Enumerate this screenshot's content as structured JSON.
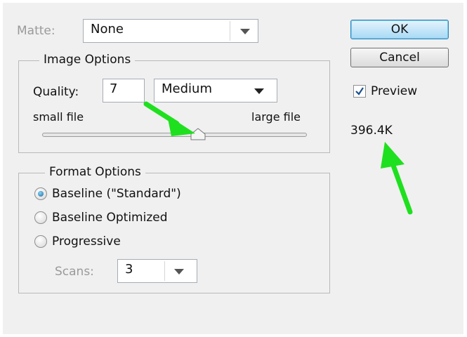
{
  "matte": {
    "label": "Matte:",
    "value": "None"
  },
  "image_options": {
    "legend": "Image Options",
    "quality_label": "Quality:",
    "quality_value": "7",
    "quality_preset": "Medium",
    "small_label": "small file",
    "large_label": "large file",
    "slider_position": 0.59
  },
  "format_options": {
    "legend": "Format Options",
    "options": [
      "Baseline (\"Standard\")",
      "Baseline Optimized",
      "Progressive"
    ],
    "selected_index": 0,
    "scans_label": "Scans:",
    "scans_value": "3"
  },
  "buttons": {
    "ok": "OK",
    "cancel": "Cancel"
  },
  "preview": {
    "label": "Preview",
    "checked": true
  },
  "file_size": "396.4K",
  "colors": {
    "accent": "#1a6aa0",
    "annotation_arrow": "#1fe01f"
  }
}
